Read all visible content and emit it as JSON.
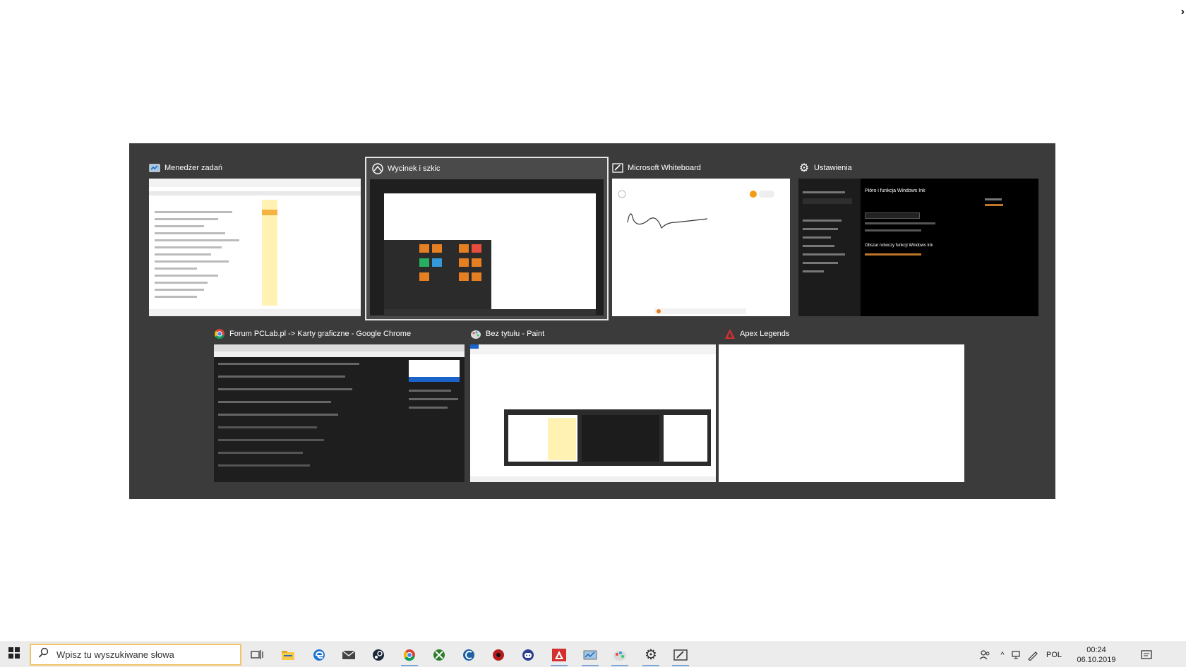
{
  "windows": [
    {
      "title": "Menedżer zadań",
      "icon": "task-manager-icon"
    },
    {
      "title": "Wycinek i szkic",
      "icon": "snip-sketch-icon"
    },
    {
      "title": "Microsoft Whiteboard",
      "icon": "whiteboard-icon"
    },
    {
      "title": "Ustawienia",
      "icon": "settings-gear-icon"
    },
    {
      "title": "Forum PCLab.pl -> Karty graficzne - Google Chrome",
      "icon": "chrome-icon"
    },
    {
      "title": "Bez tytułu - Paint",
      "icon": "paint-icon"
    },
    {
      "title": "Apex Legends",
      "icon": "apex-legends-icon"
    }
  ],
  "settings_preview": {
    "heading": "Pióro i funkcja Windows Ink",
    "section": "Obszar roboczy funkcji Windows Ink"
  },
  "taskbar": {
    "search_placeholder": "Wpisz tu wyszukiwane słowa",
    "pinned": [
      "task-view-icon",
      "file-explorer-icon",
      "edge-icon",
      "mail-icon",
      "steam-icon",
      "chrome-icon",
      "xbox-icon",
      "ccleaner-icon",
      "game-app-icon",
      "discord-icon",
      "apex-legends-icon",
      "task-manager-icon",
      "paint-icon",
      "settings-gear-icon",
      "whiteboard-icon"
    ]
  },
  "tray": {
    "language": "POL",
    "time": "00:24",
    "date": "06.10.2019"
  },
  "colors": {
    "switcher_bg": "#3b3b3b",
    "taskbar_bg": "#ececec",
    "accent": "#f2c46a"
  }
}
